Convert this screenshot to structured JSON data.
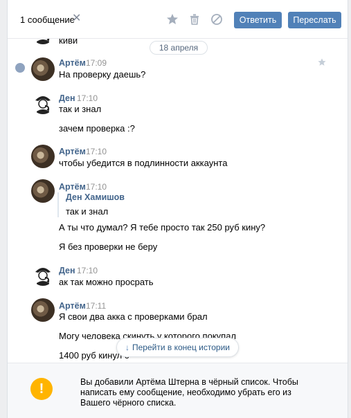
{
  "toolbar": {
    "selection_count": "1 сообщение",
    "reply_label": "Ответить",
    "forward_label": "Переслать",
    "icons": [
      "close-icon",
      "star-icon",
      "trash-icon",
      "block-icon"
    ]
  },
  "chat": {
    "top_partial_text": "киви",
    "date_divider": "18 апреля",
    "messages": [
      {
        "author": "Артём",
        "time": "17:09",
        "texts": [
          "На проверку даешь?"
        ]
      },
      {
        "author": "Ден",
        "time": "17:10",
        "texts": [
          "так и знал",
          "зачем проверка :?"
        ]
      },
      {
        "author": "Артём",
        "time": "17:10",
        "texts": [
          "чтобы убедится в подлинности аккаунта"
        ]
      },
      {
        "author": "Артём",
        "time": "17:10",
        "forwarded": {
          "author": "Ден Хамишов",
          "text": "так и знал"
        },
        "texts": [
          "А ты что думал? Я тебе просто так 250 руб кину?",
          "Я без проверки не беру"
        ]
      },
      {
        "author": "Ден",
        "time": "17:10",
        "texts": [
          "ак так можно просрать"
        ]
      },
      {
        "author": "Артём",
        "time": "17:11",
        "texts": [
          "Я свои два акка с проверками брал",
          "Могу человека скинуть у которого покупал",
          "1400 руб кинул с"
        ]
      }
    ],
    "goto_end_label": "Перейти в конец истории"
  },
  "notice": {
    "text": "Вы добавили Артёма Штерна в чёрный список. Чтобы написать ему сообщение, необходимо убрать его из Вашего чёрного списка."
  },
  "colors": {
    "accent": "#5181b8",
    "author": "#42648b",
    "warning": "#ffb400"
  }
}
